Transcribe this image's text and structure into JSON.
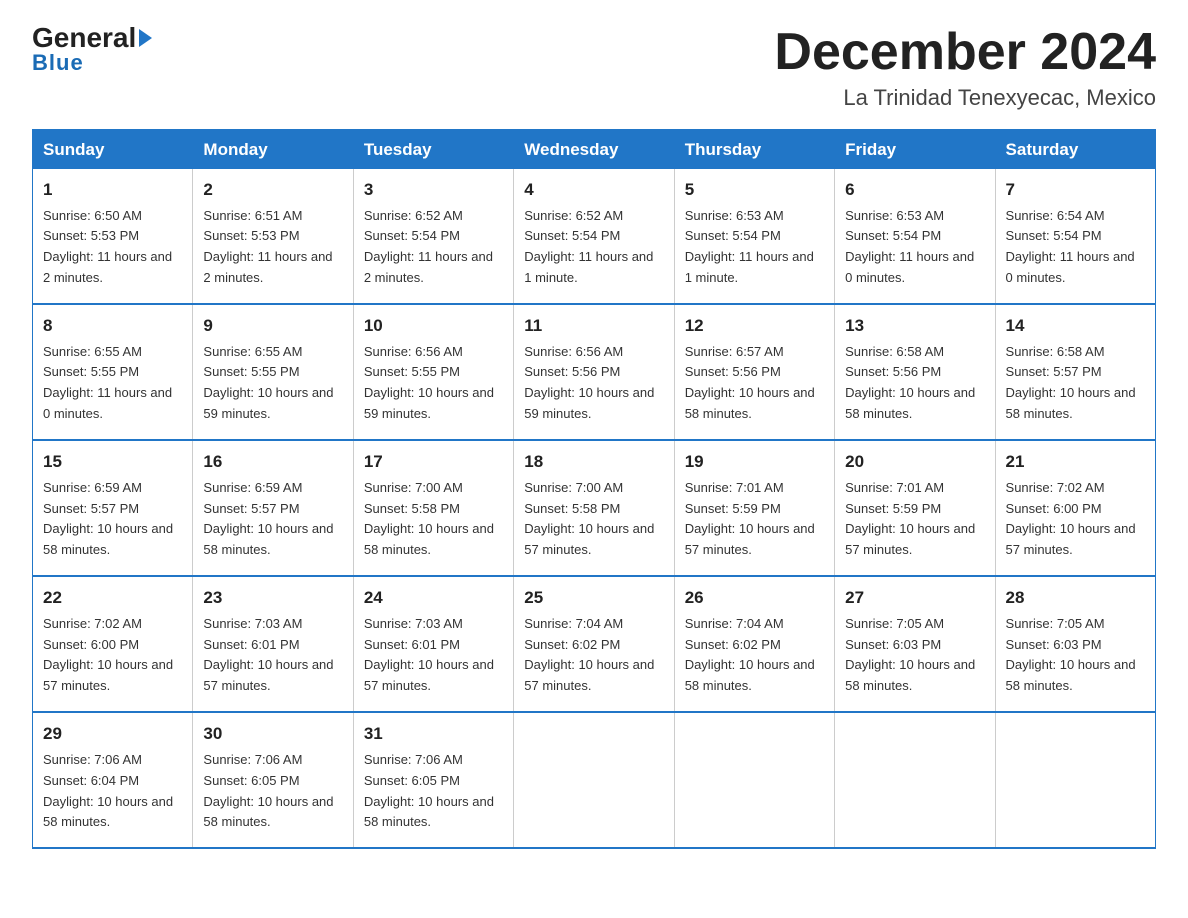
{
  "header": {
    "logo_main": "General",
    "logo_sub": "Blue",
    "month_title": "December 2024",
    "location": "La Trinidad Tenexyecac, Mexico"
  },
  "weekdays": [
    "Sunday",
    "Monday",
    "Tuesday",
    "Wednesday",
    "Thursday",
    "Friday",
    "Saturday"
  ],
  "weeks": [
    [
      {
        "day": "1",
        "sunrise": "6:50 AM",
        "sunset": "5:53 PM",
        "daylight": "11 hours and 2 minutes."
      },
      {
        "day": "2",
        "sunrise": "6:51 AM",
        "sunset": "5:53 PM",
        "daylight": "11 hours and 2 minutes."
      },
      {
        "day": "3",
        "sunrise": "6:52 AM",
        "sunset": "5:54 PM",
        "daylight": "11 hours and 2 minutes."
      },
      {
        "day": "4",
        "sunrise": "6:52 AM",
        "sunset": "5:54 PM",
        "daylight": "11 hours and 1 minute."
      },
      {
        "day": "5",
        "sunrise": "6:53 AM",
        "sunset": "5:54 PM",
        "daylight": "11 hours and 1 minute."
      },
      {
        "day": "6",
        "sunrise": "6:53 AM",
        "sunset": "5:54 PM",
        "daylight": "11 hours and 0 minutes."
      },
      {
        "day": "7",
        "sunrise": "6:54 AM",
        "sunset": "5:54 PM",
        "daylight": "11 hours and 0 minutes."
      }
    ],
    [
      {
        "day": "8",
        "sunrise": "6:55 AM",
        "sunset": "5:55 PM",
        "daylight": "11 hours and 0 minutes."
      },
      {
        "day": "9",
        "sunrise": "6:55 AM",
        "sunset": "5:55 PM",
        "daylight": "10 hours and 59 minutes."
      },
      {
        "day": "10",
        "sunrise": "6:56 AM",
        "sunset": "5:55 PM",
        "daylight": "10 hours and 59 minutes."
      },
      {
        "day": "11",
        "sunrise": "6:56 AM",
        "sunset": "5:56 PM",
        "daylight": "10 hours and 59 minutes."
      },
      {
        "day": "12",
        "sunrise": "6:57 AM",
        "sunset": "5:56 PM",
        "daylight": "10 hours and 58 minutes."
      },
      {
        "day": "13",
        "sunrise": "6:58 AM",
        "sunset": "5:56 PM",
        "daylight": "10 hours and 58 minutes."
      },
      {
        "day": "14",
        "sunrise": "6:58 AM",
        "sunset": "5:57 PM",
        "daylight": "10 hours and 58 minutes."
      }
    ],
    [
      {
        "day": "15",
        "sunrise": "6:59 AM",
        "sunset": "5:57 PM",
        "daylight": "10 hours and 58 minutes."
      },
      {
        "day": "16",
        "sunrise": "6:59 AM",
        "sunset": "5:57 PM",
        "daylight": "10 hours and 58 minutes."
      },
      {
        "day": "17",
        "sunrise": "7:00 AM",
        "sunset": "5:58 PM",
        "daylight": "10 hours and 58 minutes."
      },
      {
        "day": "18",
        "sunrise": "7:00 AM",
        "sunset": "5:58 PM",
        "daylight": "10 hours and 57 minutes."
      },
      {
        "day": "19",
        "sunrise": "7:01 AM",
        "sunset": "5:59 PM",
        "daylight": "10 hours and 57 minutes."
      },
      {
        "day": "20",
        "sunrise": "7:01 AM",
        "sunset": "5:59 PM",
        "daylight": "10 hours and 57 minutes."
      },
      {
        "day": "21",
        "sunrise": "7:02 AM",
        "sunset": "6:00 PM",
        "daylight": "10 hours and 57 minutes."
      }
    ],
    [
      {
        "day": "22",
        "sunrise": "7:02 AM",
        "sunset": "6:00 PM",
        "daylight": "10 hours and 57 minutes."
      },
      {
        "day": "23",
        "sunrise": "7:03 AM",
        "sunset": "6:01 PM",
        "daylight": "10 hours and 57 minutes."
      },
      {
        "day": "24",
        "sunrise": "7:03 AM",
        "sunset": "6:01 PM",
        "daylight": "10 hours and 57 minutes."
      },
      {
        "day": "25",
        "sunrise": "7:04 AM",
        "sunset": "6:02 PM",
        "daylight": "10 hours and 57 minutes."
      },
      {
        "day": "26",
        "sunrise": "7:04 AM",
        "sunset": "6:02 PM",
        "daylight": "10 hours and 58 minutes."
      },
      {
        "day": "27",
        "sunrise": "7:05 AM",
        "sunset": "6:03 PM",
        "daylight": "10 hours and 58 minutes."
      },
      {
        "day": "28",
        "sunrise": "7:05 AM",
        "sunset": "6:03 PM",
        "daylight": "10 hours and 58 minutes."
      }
    ],
    [
      {
        "day": "29",
        "sunrise": "7:06 AM",
        "sunset": "6:04 PM",
        "daylight": "10 hours and 58 minutes."
      },
      {
        "day": "30",
        "sunrise": "7:06 AM",
        "sunset": "6:05 PM",
        "daylight": "10 hours and 58 minutes."
      },
      {
        "day": "31",
        "sunrise": "7:06 AM",
        "sunset": "6:05 PM",
        "daylight": "10 hours and 58 minutes."
      },
      null,
      null,
      null,
      null
    ]
  ]
}
